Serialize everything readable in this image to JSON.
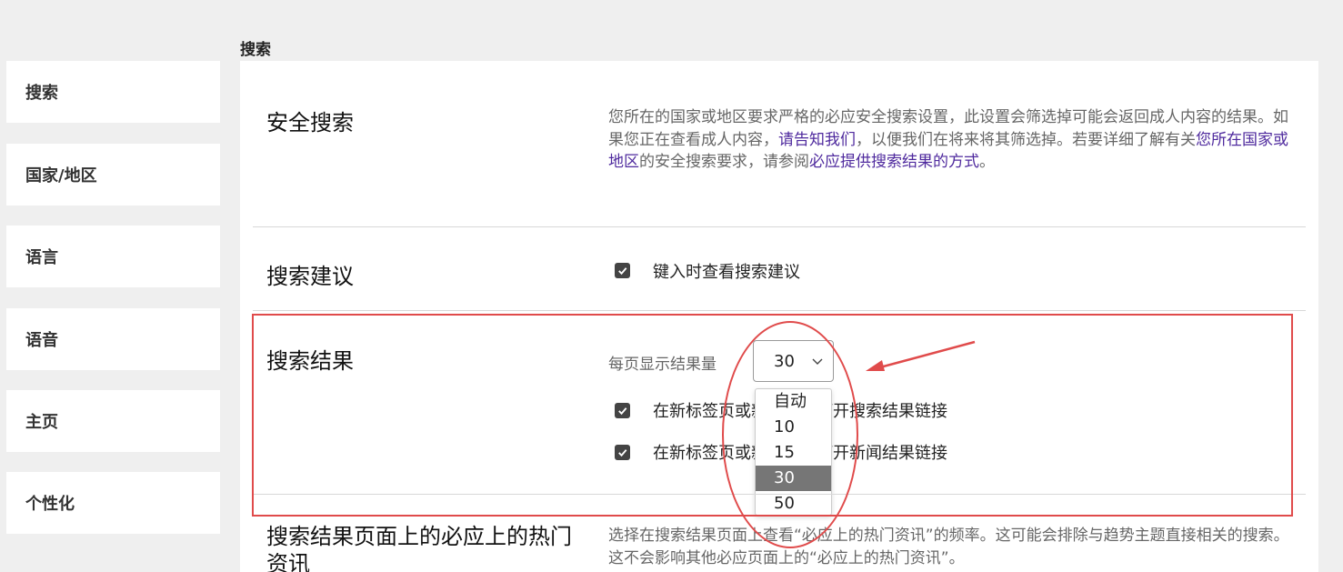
{
  "page": {
    "heading": "搜索"
  },
  "sidebar": {
    "items": [
      {
        "label": "搜索"
      },
      {
        "label": "国家/地区"
      },
      {
        "label": "语言"
      },
      {
        "label": "语音"
      },
      {
        "label": "主页"
      },
      {
        "label": "个性化"
      }
    ]
  },
  "safe_search": {
    "title": "安全搜索",
    "desc_part1": "您所在的国家或地区要求严格的必应安全搜索设置，此设置会筛选掉可能会返回成人内容的结果。如果您正在查看成人内容，",
    "link_tell_us": "请告知我们",
    "desc_part2": "，以便我们在将来将其筛选掉。若要详细了解有关",
    "link_region": "您所在国家或地区",
    "desc_part3": "的安全搜索要求，请参阅",
    "link_how": "必应提供搜索结果的方式",
    "desc_part4": "。"
  },
  "suggestions": {
    "title": "搜索建议",
    "checkbox_label": "键入时查看搜索建议",
    "checked": true
  },
  "results": {
    "title": "搜索结果",
    "per_page_label": "每页显示结果量",
    "per_page_value": "30",
    "options": [
      "自动",
      "10",
      "15",
      "30",
      "50"
    ],
    "selected_option": "30",
    "open_results_label": "在新标签页或新窗口中打开搜索结果链接",
    "open_results_checked": true,
    "open_news_label": "在新标签页或新窗口中打开新闻结果链接",
    "open_news_checked": true
  },
  "trending": {
    "title": "搜索结果页面上的必应上的热门资讯",
    "desc": "选择在搜索结果页面上查看“必应上的热门资讯”的频率。这可能会排除与趋势主题直接相关的搜索。这不会影响其他必应页面上的“必应上的热门资讯”。"
  },
  "colors": {
    "annotation": "#e04b4b",
    "link": "#4f2a9e",
    "selected_option_bg": "#767676"
  }
}
